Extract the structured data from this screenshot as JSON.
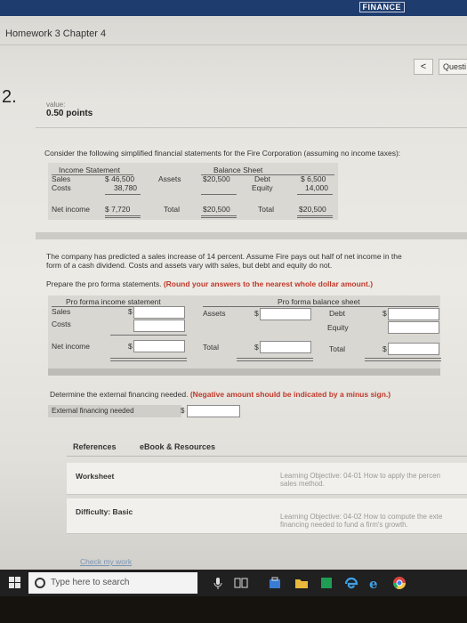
{
  "header": {
    "brand": "FINANCE",
    "assignment_title": "Homework 3 Chapter 4",
    "prev_button": "<",
    "question_nav_label": "Questi"
  },
  "question": {
    "number": "2.",
    "value_label": "value:",
    "points": "0.50 points",
    "intro": "Consider the following simplified financial statements for the Fire Corporation (assuming no income taxes):"
  },
  "statements": {
    "income_title": "Income Statement",
    "balance_title": "Balance Sheet",
    "sales_label": "Sales",
    "sales_value": "$ 46,500",
    "costs_label": "Costs",
    "costs_value": "38,780",
    "net_income_label": "Net income",
    "net_income_value": "$ 7,720",
    "assets_label": "Assets",
    "assets_value": "$20,500",
    "debt_label": "Debt",
    "debt_value": "$ 6,500",
    "equity_label": "Equity",
    "equity_value": "14,000",
    "total_label": "Total",
    "total_assets_value": "$20,500",
    "total_label_2": "Total",
    "total_liab_value": "$20,500"
  },
  "prompt": {
    "para1_line1": "The company has predicted a sales increase of 14 percent. Assume Fire pays out half of net income in the",
    "para1_line2": "form of a cash dividend. Costs and assets vary with sales, but debt and equity do not.",
    "instruction": "Prepare the pro forma statements.",
    "instruction_note": "(Round your answers to the nearest whole dollar amount.)"
  },
  "pro_forma": {
    "income_title": "Pro forma income statement",
    "balance_title": "Pro forma balance sheet",
    "sales_label": "Sales",
    "costs_label": "Costs",
    "net_income_label": "Net income",
    "assets_label": "Assets",
    "total_label": "Total",
    "debt_label": "Debt",
    "equity_label": "Equity",
    "total_label_2": "Total",
    "currency": "$"
  },
  "efn": {
    "question": "Determine the external financing needed.",
    "note": "(Negative amount should be indicated by a minus sign.)",
    "label": "External financing needed",
    "currency": "$"
  },
  "tabs": {
    "references": "References",
    "ebook": "eBook & Resources"
  },
  "references": [
    {
      "title": "Worksheet",
      "objective_line1": "Learning Objective: 04-01 How to apply the percen",
      "objective_line2": "sales method."
    },
    {
      "title": "Difficulty: Basic",
      "objective_line1": "Learning Objective: 04-02 How to compute the exte",
      "objective_line2": "financing needed to fund a firm's growth."
    }
  ],
  "check_link": "Check my work",
  "taskbar": {
    "search_placeholder": "Type here to search"
  },
  "colors": {
    "brand_bar": "#1e3c6e",
    "instruction_red": "#c0392b",
    "link": "#7a95b8"
  }
}
